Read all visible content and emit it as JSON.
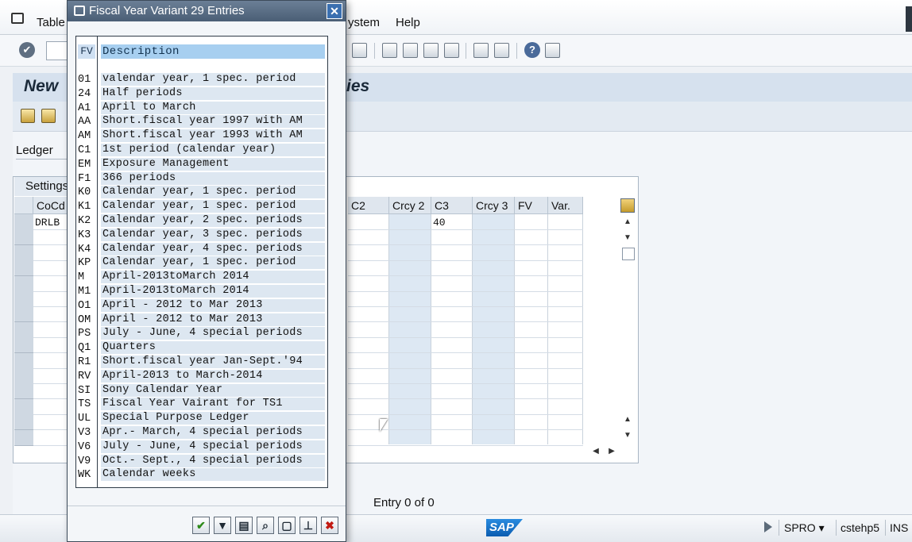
{
  "menubar": {
    "items": [
      "Table",
      "ystem",
      "Help"
    ]
  },
  "window": {
    "title_left": "New",
    "title_right": "ies"
  },
  "ledger": {
    "label": "Ledger"
  },
  "settings": {
    "tab_label": "Settings",
    "columns": [
      "CoCd",
      "C2",
      "Crcy 2",
      "C3",
      "Crcy 3",
      "FV",
      "Var."
    ],
    "row1": {
      "cocd": "DRLB",
      "c3": "40"
    }
  },
  "entry_info": "Entry 0 of 0",
  "statusbar": {
    "logo": "SAP",
    "system": "SPRO",
    "server": "cstehp5",
    "mode": "INS"
  },
  "dialog": {
    "title": "Fiscal Year Variant 29 Entries",
    "close_glyph": "✕",
    "header": {
      "fv": "FV",
      "description": "Description"
    },
    "rows": [
      {
        "fv": "01",
        "description": "valendar year, 1 spec. period"
      },
      {
        "fv": "24",
        "description": "Half periods"
      },
      {
        "fv": "A1",
        "description": "April to March"
      },
      {
        "fv": "AA",
        "description": "Short.fiscal year 1997 with AM"
      },
      {
        "fv": "AM",
        "description": "Short.fiscal year 1993 with AM"
      },
      {
        "fv": "C1",
        "description": "1st period (calendar year)"
      },
      {
        "fv": "EM",
        "description": "Exposure Management"
      },
      {
        "fv": "F1",
        "description": "366 periods"
      },
      {
        "fv": "K0",
        "description": "Calendar year, 1 spec. period"
      },
      {
        "fv": "K1",
        "description": "Calendar year, 1 spec. period"
      },
      {
        "fv": "K2",
        "description": "Calendar year, 2 spec. periods"
      },
      {
        "fv": "K3",
        "description": "Calendar year, 3 spec. periods"
      },
      {
        "fv": "K4",
        "description": "Calendar year, 4 spec. periods"
      },
      {
        "fv": "KP",
        "description": "Calendar year, 1 spec. period"
      },
      {
        "fv": "M",
        "description": "April-2013toMarch 2014"
      },
      {
        "fv": "M1",
        "description": "April-2013toMarch 2014"
      },
      {
        "fv": "O1",
        "description": "April - 2012 to Mar 2013"
      },
      {
        "fv": "OM",
        "description": "April - 2012 to Mar 2013"
      },
      {
        "fv": "PS",
        "description": "July - June, 4 special periods"
      },
      {
        "fv": "Q1",
        "description": "Quarters"
      },
      {
        "fv": "R1",
        "description": "Short.fiscal year Jan-Sept.'94"
      },
      {
        "fv": "RV",
        "description": "April-2013 to March-2014"
      },
      {
        "fv": "SI",
        "description": "Sony Calendar Year"
      },
      {
        "fv": "TS",
        "description": "Fiscal Year Vairant for TS1"
      },
      {
        "fv": "UL",
        "description": "Special Purpose Ledger"
      },
      {
        "fv": "V3",
        "description": "Apr.- March, 4 special periods"
      },
      {
        "fv": "V6",
        "description": "July - June, 4 special periods"
      },
      {
        "fv": "V9",
        "description": "Oct.- Sept., 4 special periods"
      },
      {
        "fv": "WK",
        "description": "Calendar weeks"
      }
    ],
    "footer_buttons": [
      {
        "name": "confirm-button",
        "glyph": "✔"
      },
      {
        "name": "filter-button",
        "glyph": "▼"
      },
      {
        "name": "restrict-button",
        "glyph": "▤"
      },
      {
        "name": "find-button",
        "glyph": "⌕"
      },
      {
        "name": "new-entry-button",
        "glyph": "▢"
      },
      {
        "name": "personal-list-button",
        "glyph": "⊥"
      },
      {
        "name": "cancel-button",
        "glyph": "✖"
      }
    ]
  },
  "colors": {
    "dialog_title_bg": "#5a6e86",
    "description_header_bg": "#a7cff0",
    "row_bg": "#dde7f1"
  }
}
